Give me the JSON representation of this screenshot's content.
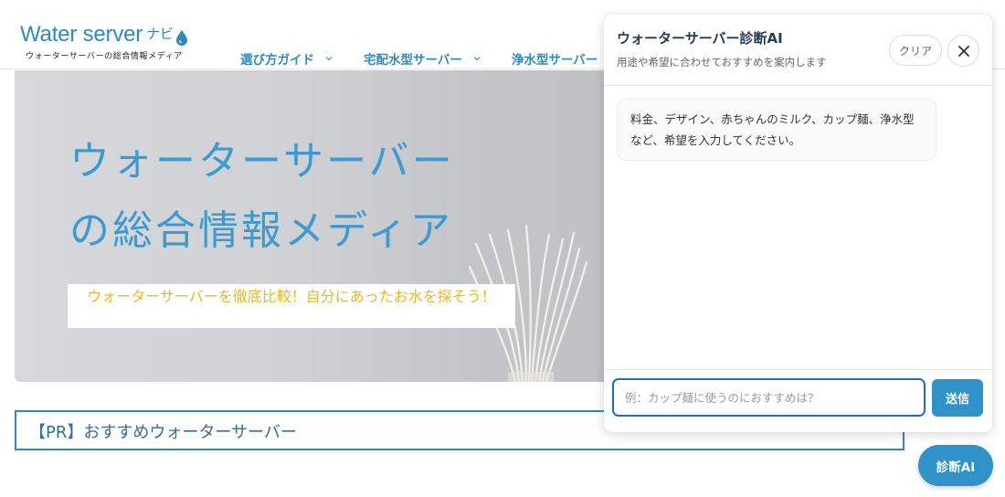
{
  "header": {
    "logo_text": "Water server",
    "logo_suffix": "ナビ",
    "logo_tagline": "ウォーターサーバーの総合情報メディア",
    "nav": [
      {
        "label": "選び方ガイド"
      },
      {
        "label": "宅配水型サーバー"
      },
      {
        "label": "浄水型サーバー"
      }
    ]
  },
  "hero": {
    "title_line1": "ウォーターサーバー",
    "title_line2": "の総合情報メディア",
    "subtitle": "ウォーターサーバーを徹底比較！自分にあったお水を探そう！"
  },
  "pr": {
    "heading": "【PR】おすすめウォーターサーバー"
  },
  "chat": {
    "title": "ウォーターサーバー診断AI",
    "description": "用途や希望に合わせておすすめを案内します",
    "clear_label": "クリア",
    "message": "料金、デザイン、赤ちゃんのミルク、カップ麺、浄水型など、希望を入力してください。",
    "input_placeholder": "例：カップ麺に使うのにおすすめは？",
    "input_value": "",
    "send_label": "送信"
  },
  "fab": {
    "label": "診断AI"
  },
  "colors": {
    "brand": "#2e8ac4",
    "accent_yellow": "#e8b922",
    "button_blue": "#2d93c8"
  }
}
